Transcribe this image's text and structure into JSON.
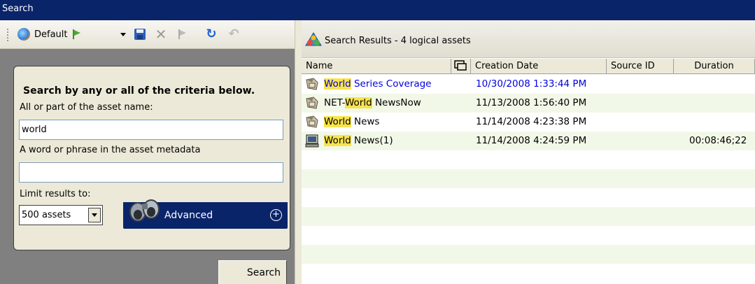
{
  "window": {
    "title": "Search"
  },
  "toolbar": {
    "preset_label": "Default",
    "icons": [
      "globe-icon",
      "flag-icon",
      "chevron-down-icon",
      "save-icon",
      "delete-icon",
      "filter-icon",
      "refresh-icon",
      "undo-icon"
    ]
  },
  "search_form": {
    "heading": "Search by any or all of the criteria below.",
    "name_label": "All or part of the asset name:",
    "name_value": "world",
    "metadata_label": "A word or phrase in the asset metadata",
    "metadata_value": "",
    "limit_label": "Limit results to:",
    "limit_value": "500 assets",
    "advanced_label": "Advanced",
    "search_button": "Search"
  },
  "results": {
    "title": "Search Results - 4 logical assets",
    "columns": [
      "Name",
      "Creation Date",
      "Source ID",
      "Duration"
    ],
    "rows": [
      {
        "name_hl": "World",
        "name_rest": " Series Coverage",
        "name_pre": "",
        "date": "10/30/2008 1:33:44 PM",
        "source_id": "",
        "duration": "",
        "icon": "asset-group-icon"
      },
      {
        "name_pre": "NET-",
        "name_hl": "World",
        "name_rest": " NewsNow",
        "date": "11/13/2008 1:56:40 PM",
        "source_id": "",
        "duration": "",
        "icon": "asset-group-icon"
      },
      {
        "name_pre": "",
        "name_hl": "World",
        "name_rest": " News",
        "date": "11/14/2008 4:23:38 PM",
        "source_id": "",
        "duration": "",
        "icon": "asset-group-icon"
      },
      {
        "name_pre": "",
        "name_hl": "World",
        "name_rest": " News(1)",
        "date": "11/14/2008 4:24:59 PM",
        "source_id": "",
        "duration": "00:08:46;22",
        "icon": "video-asset-icon"
      }
    ]
  },
  "colors": {
    "titlebar": "#0a246a",
    "highlight": "#f7e34e",
    "selected_text": "#0000e0",
    "alt_row": "#f2f8e8"
  }
}
